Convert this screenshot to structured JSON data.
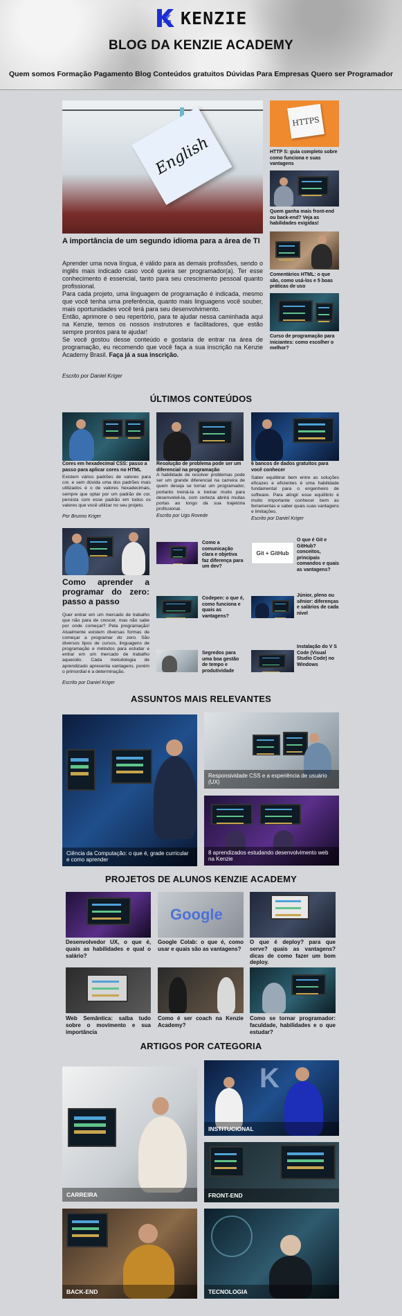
{
  "header": {
    "logo_text": "KENZIE",
    "blog_title": "BLOG DA KENZIE ACADEMY",
    "nav": [
      "Quem somos",
      "Formação",
      "Pagamento",
      "Blog",
      "Conteúdos gratuitos",
      "Dúvidas",
      "Para Empresas",
      "Quero ser Programador"
    ]
  },
  "featured": {
    "image_text": "English",
    "title": "A importância de um segundo idioma para a área de TI",
    "paragraphs": [
      "Aprender uma nova língua, é válido para as demais profissões, sendo o inglês mais indicado caso você queira ser programador(a). Ter esse conhecimento é essencial, tanto para seu crescimento pessoal quanto profissional.",
      "Para cada projeto, uma linguagem de programação é indicada, mesmo que você tenha uma preferência, quanto mais linguagens você souber, mais oportunidades você terá para seu desenvolvimento.",
      "Então, aprimore o seu repertório, para te ajudar nessa caminhada aqui na Kenzie, temos os nossos instrutores e facilitadores, que estão sempre prontos para te ajudar!",
      "Se você gostou desse conteúdo e gostaria de entrar na área de programação, eu recomendo que você faça a sua inscrição na Kenzie Academy Brasil."
    ],
    "cta": "Faça já a sua inscrição.",
    "author": "Escrito por Daniel Kriger"
  },
  "side_posts": [
    {
      "image_text": "HTTPS",
      "title": "HTTP S: guia completo sobre como funciona e suas vantagens"
    },
    {
      "title": "Quem ganha mais front-end ou back-end? Veja as habilidades exigidas!"
    },
    {
      "title": "Comentários HTML: o que são, como usá-los e 5 boas práticas de uso"
    },
    {
      "title": "Curso de programação para iniciantes: como escolher o melhor?"
    }
  ],
  "latest": {
    "heading": "ÚLTIMOS CONTEÚDOS",
    "cards": [
      {
        "title": "Cores em hexadecimal CSS: passo a passo para aplicar cores no HTML",
        "text": "Existem vários padrões de valores para cor, e sem dúvida uma dos padrões mais utilizados é o de valores hexadecimais, sempre que optar por um padrão de cor, persista com esse padrão em todos os valores que você utilizar no seu projeto.",
        "author": "Por Brunno Kriger"
      },
      {
        "title": "Resolução de problema pode ser um diferencial na programação",
        "text": "A habilidade de resolver problemas pode ser um grande diferencial na carreira de quem deseja se tornar um programador, portanto treiná-la e treinar muito para desenvolvê-la, com certeza abrirá muitas portas ao longo da sua trajetória profissional.",
        "author": "Escrito por Ugo Rovede"
      },
      {
        "title": "6 bancos de dados gratuitos para você conhecer",
        "text": "Saber equilibrar bem entre as soluções eficazes e eficientes é uma habilidade fundamental para o engenheiro de software. Para atingir esse equilíbrio é muito importante conhecer bem as ferramentas e saber quais suas vantagens e limitações.",
        "author": "Escrito por Daniel Kriger"
      }
    ],
    "big": {
      "title": "Como aprender a programar do zero: passo a passo",
      "text": "Quer entrar em um mercado de trabalho que não para de crescer, mas não sabe por onde começar? Pela programação! Atualmente existem diversas formas de começar a programar do zero. São diversos tipos de cursos, linguagens de programação e métodos para estudar e entrar em um mercado de trabalho aquecido. Cada metodologia de aprendizado apresenta vantagens, porém o primordial é a determinação.",
      "author": "Escrito por Daniel Kriger"
    },
    "small": [
      {
        "title": "Como a comunicação clara e objetiva faz diferença para um dev?"
      },
      {
        "title": "O que é Git e GitHub? conceitos, principais comandos e quais as vantagens?",
        "image_text": "Git  +  GitHub"
      },
      {
        "title": "Codepen: o que é, como funciona e quais as vantagens?"
      },
      {
        "title": "Júnior, pleno ou sênior: diferenças e salários de cada nível"
      },
      {
        "title": "Segredos para uma boa gestão de tempo e produtividade"
      },
      {
        "title": "Instalação do V S Code (Visual Studio Code) no Windows"
      }
    ]
  },
  "relevant": {
    "heading": "ASSUNTOS MAIS RELEVANTES",
    "items": [
      {
        "caption": "Ciência da Computação: o que é, grade curricular e como aprender"
      },
      {
        "caption": "Responsividade CSS e a experiência de usuário (UX)"
      },
      {
        "caption": "8 aprendizados estudando desenvolvimento web na Kenzie"
      }
    ]
  },
  "projects": {
    "heading": "PROJETOS DE ALUNOS KENZIE ACADEMY",
    "items": [
      {
        "title": "Desenvolvedor UX, o que é, quais as habilidades e qual o salário?"
      },
      {
        "title": "Google Colab: o que é, como usar e quais são as vantagens?",
        "image_text": "Google"
      },
      {
        "title": "O que é deploy? para que serve? quais as vantagens? dicas de como fazer um bom deploy."
      },
      {
        "title": "Web Semântica: saiba tudo sobre o movimento e sua importância"
      },
      {
        "title": "Como é ser coach na Kenzie Academy?"
      },
      {
        "title": "Como se tornar programador: faculdade, habilidades e o que estudar?"
      }
    ]
  },
  "categories": {
    "heading": "ARTIGOS POR CATEGORIA",
    "items": [
      {
        "label": "INSTITUCIONAL"
      },
      {
        "label": "CARREIRA"
      },
      {
        "label": "FRONT-END"
      },
      {
        "label": "BACK-END"
      },
      {
        "label": "TECNOLOGIA"
      }
    ]
  }
}
